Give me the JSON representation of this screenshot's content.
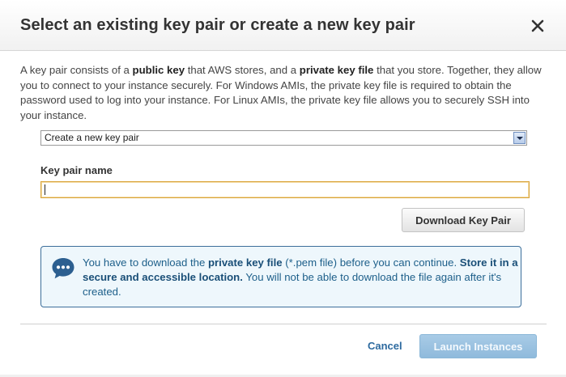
{
  "dialog": {
    "title": "Select an existing key pair or create a new key pair"
  },
  "description": {
    "part1": "A key pair consists of a ",
    "bold1": "public key",
    "part2": " that AWS stores, and a ",
    "bold2": "private key file",
    "part3": " that you store. Together, they allow you to connect to your instance securely. For Windows AMIs, the private key file is required to obtain the password used to log into your instance. For Linux AMIs, the private key file allows you to securely SSH into your instance."
  },
  "key_pair_select": {
    "selected": "Create a new key pair"
  },
  "key_pair_name": {
    "label": "Key pair name",
    "value": ""
  },
  "buttons": {
    "download": "Download Key Pair",
    "cancel": "Cancel",
    "launch": "Launch Instances"
  },
  "info": {
    "t1": "You have to download the ",
    "b1": "private key file",
    "t2": " (*.pem file) before you can continue. ",
    "b2": "Store it in a secure and accessible location.",
    "t3": " You will not be able to download the file again after it's created."
  },
  "icons": {
    "close": "close-icon",
    "dropdown": "chevron-down-icon",
    "info": "speech-bubble-icon"
  },
  "colors": {
    "info_border": "#3d6f9b",
    "info_background": "#eef7fc",
    "link": "#2d6a9f",
    "launch_disabled": "#9bc3e2"
  }
}
